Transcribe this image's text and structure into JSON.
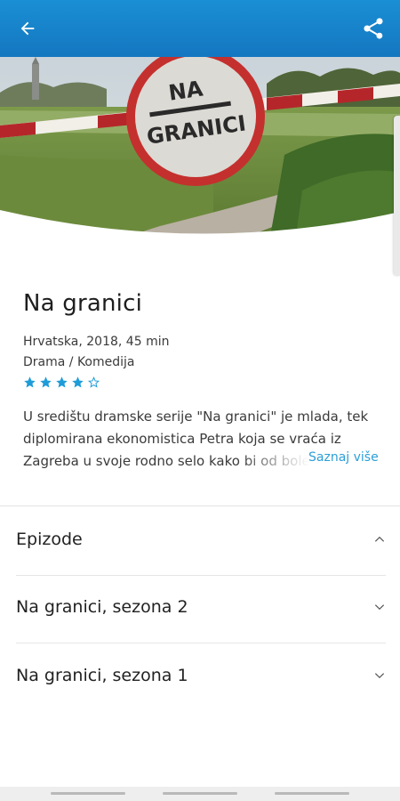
{
  "header": {
    "back_icon": "arrow-left-icon",
    "share_icon": "share-icon",
    "accent": "#1a8fd4"
  },
  "hero": {
    "sign_line1": "NA",
    "sign_line2": "GRANICI"
  },
  "show": {
    "title": "Na granici",
    "meta_line1": "Hrvatska, 2018, 45 min",
    "meta_line2": "Drama / Komedija",
    "rating": 4,
    "rating_max": 5,
    "description_line1": "U središtu dramske serije \"Na granici\" je mlada, tek",
    "description_line2": "diplomirana ekonomistica Petra koja se vraća iz",
    "description_line3": "Zagreba u svoje rodno selo kako bi od bolesne",
    "more_label": "Saznaj više"
  },
  "sections": [
    {
      "label": "Epizode",
      "expanded": true
    },
    {
      "label": "Na granici, sezona 2",
      "expanded": false
    },
    {
      "label": "Na granici, sezona 1",
      "expanded": false
    }
  ]
}
